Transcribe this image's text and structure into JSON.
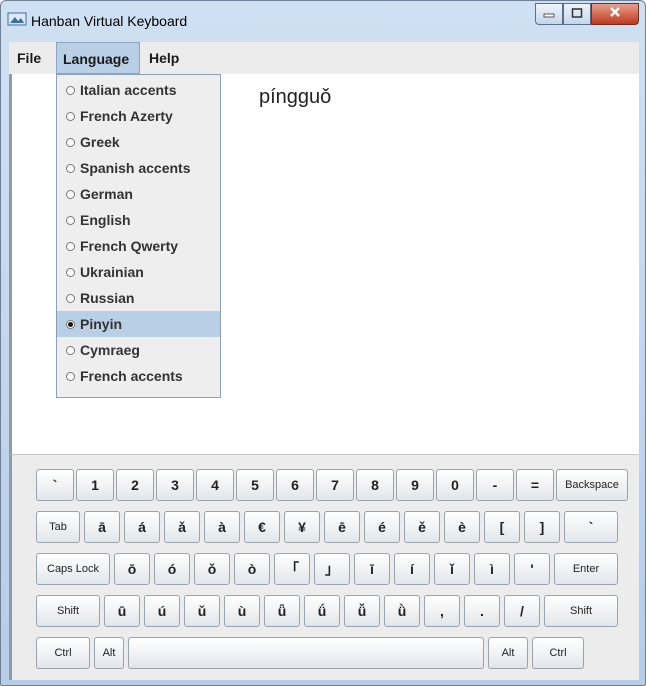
{
  "window": {
    "title": "Hanban Virtual Keyboard"
  },
  "menubar": {
    "file": "File",
    "language": "Language",
    "help": "Help"
  },
  "editor": {
    "text": "píngguǒ"
  },
  "language_menu": {
    "items": [
      {
        "label": "Italian accents",
        "selected": false
      },
      {
        "label": "French Azerty",
        "selected": false
      },
      {
        "label": "Greek",
        "selected": false
      },
      {
        "label": "Spanish accents",
        "selected": false
      },
      {
        "label": "German",
        "selected": false
      },
      {
        "label": "English",
        "selected": false
      },
      {
        "label": "French Qwerty",
        "selected": false
      },
      {
        "label": "Ukrainian",
        "selected": false
      },
      {
        "label": "Russian",
        "selected": false
      },
      {
        "label": "Pinyin",
        "selected": true
      },
      {
        "label": "Cymraeg",
        "selected": false
      },
      {
        "label": "French accents",
        "selected": false
      }
    ]
  },
  "keyboard": {
    "rows": [
      [
        "`",
        "1",
        "2",
        "3",
        "4",
        "5",
        "6",
        "7",
        "8",
        "9",
        "0",
        "-",
        "=",
        "Backspace"
      ],
      [
        "Tab",
        "ā",
        "á",
        "ǎ",
        "à",
        "€",
        "¥",
        "ē",
        "é",
        "ě",
        "è",
        "[",
        "]",
        "`"
      ],
      [
        "Caps Lock",
        "ō",
        "ó",
        "ǒ",
        "ò",
        "「",
        "」",
        "ī",
        "í",
        "ǐ",
        "ì",
        "'",
        "Enter"
      ],
      [
        "Shift",
        "ū",
        "ú",
        "ǔ",
        "ù",
        "ǖ",
        "ǘ",
        "ǚ",
        "ǜ",
        ",",
        ".",
        "/",
        "Shift"
      ],
      [
        "Ctrl",
        "Alt",
        "",
        "Alt",
        "Ctrl"
      ]
    ]
  }
}
